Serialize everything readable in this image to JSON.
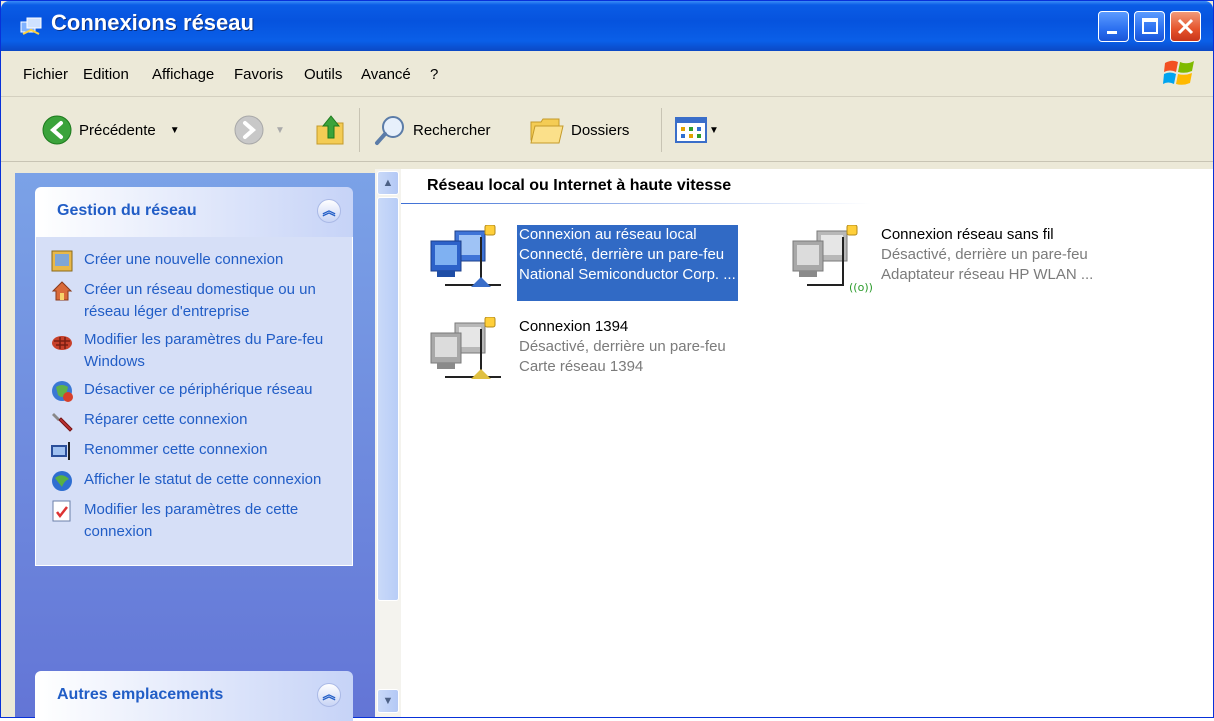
{
  "window": {
    "title": "Connexions réseau",
    "title_icon": "network-connections-icon"
  },
  "menu": [
    {
      "label": "Fichier",
      "accel": "F"
    },
    {
      "label": "Edition",
      "accel": "E"
    },
    {
      "label": "Affichage",
      "accel": "h"
    },
    {
      "label": "Favoris",
      "accel": "v"
    },
    {
      "label": "Outils",
      "accel": "O"
    },
    {
      "label": "Avancé",
      "accel": "A"
    },
    {
      "label": "?",
      "accel": "?"
    }
  ],
  "toolbar": {
    "back_label": "Précédente",
    "search_label": "Rechercher",
    "folders_label": "Dossiers"
  },
  "tasks_panel": {
    "title": "Gestion du réseau",
    "collapse_icon": "collapse-up-icon",
    "items": [
      {
        "label": "Créer une nouvelle connexion",
        "icon": "new-connection-icon"
      },
      {
        "label": "Créer un réseau domestique ou un réseau léger d'entreprise",
        "icon": "home-network-icon"
      },
      {
        "label": "Modifier les paramètres du Pare-feu Windows",
        "icon": "firewall-icon"
      },
      {
        "label": "Désactiver ce périphérique réseau",
        "icon": "disable-device-icon"
      },
      {
        "label": "Réparer cette connexion",
        "icon": "repair-icon"
      },
      {
        "label": "Renommer cette connexion",
        "icon": "rename-icon"
      },
      {
        "label": "Afficher le statut de cette connexion",
        "icon": "status-icon"
      },
      {
        "label": "Modifier les paramètres de cette connexion",
        "icon": "settings-icon"
      }
    ]
  },
  "other_panel": {
    "title": "Autres emplacements"
  },
  "content": {
    "group_title": "Réseau local ou Internet à haute vitesse",
    "connections": [
      {
        "name": "Connexion au réseau local",
        "status": "Connecté, derrière un pare-feu",
        "device": "National Semiconductor Corp. ...",
        "selected": true,
        "enabled": true
      },
      {
        "name": "Connexion réseau sans fil",
        "status": "Désactivé, derrière un pare-feu",
        "device": "Adaptateur réseau HP WLAN ...",
        "selected": false,
        "enabled": false
      },
      {
        "name": "Connexion 1394",
        "status": "Désactivé, derrière un pare-feu",
        "device": "Carte réseau 1394",
        "selected": false,
        "enabled": false
      }
    ]
  },
  "colors": {
    "titlebar": "#0653de",
    "link": "#215dc6",
    "selection": "#316ac5"
  }
}
